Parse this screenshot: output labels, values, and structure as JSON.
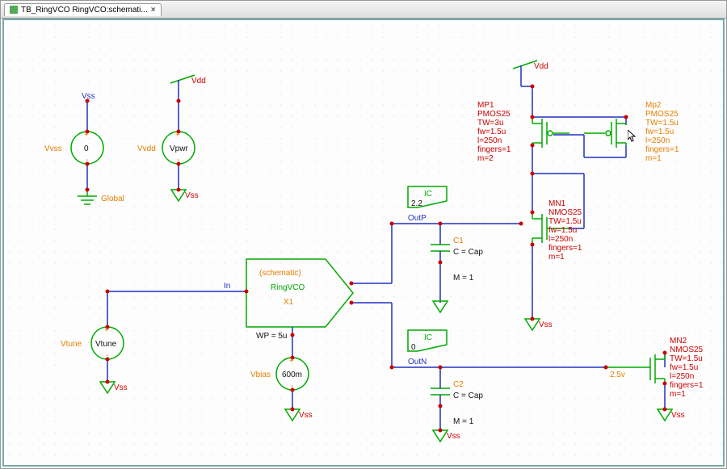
{
  "tab": {
    "title": "TB_RingVCO RingVCO:schemati...",
    "close": "×"
  },
  "nets": {
    "vss": "Vss",
    "vdd": "Vdd",
    "global": "Global",
    "in": "In",
    "outp": "OutP",
    "outn": "OutN"
  },
  "srcs": {
    "vvss": {
      "name": "Vvss",
      "val": "0"
    },
    "vvdd": {
      "name": "Vvdd",
      "comp": "Vpwr"
    },
    "vtune": {
      "name": "Vtune",
      "comp": "Vtune"
    },
    "vbias": {
      "name": "Vbias",
      "val": "600m"
    }
  },
  "block": {
    "kind": "(schematic)",
    "name": "RingVCO",
    "inst": "X1",
    "param": "WP = 5u"
  },
  "caps": {
    "c1": {
      "name": "C1",
      "l1": "C = Cap",
      "l2": "M = 1"
    },
    "c2": {
      "name": "C2",
      "l1": "C = Cap",
      "l2": "M = 1"
    }
  },
  "ic": {
    "label": "IC",
    "v1": "2.2",
    "v2": "0"
  },
  "mos": {
    "mp1": {
      "name": "MP1",
      "model": "PMOS25",
      "tw": "TW=3u",
      "fw": "fw=1.5u",
      "l": "l=250n",
      "fing": "fingers=1",
      "m": "m=2"
    },
    "mp2": {
      "name": "Mp2",
      "model": "PMOS25",
      "tw": "TW=1.5u",
      "fw": "fw=1.5u",
      "l": "l=250n",
      "fing": "fingers=1",
      "m": "m=1"
    },
    "mn1": {
      "name": "MN1",
      "model": "NMOS25",
      "tw": "TW=1.5u",
      "fw": "fw=1.5u",
      "l": "l=250n",
      "fing": "fingers=1",
      "m": "m=1"
    },
    "mn2": {
      "name": "MN2",
      "model": "NMOS25",
      "tw": "TW=1.5u",
      "fw": "fw=1.5u",
      "l": "l=250n",
      "fing": "fingers=1",
      "m": "m=1"
    }
  },
  "misc": {
    "probe": "2.5v"
  }
}
